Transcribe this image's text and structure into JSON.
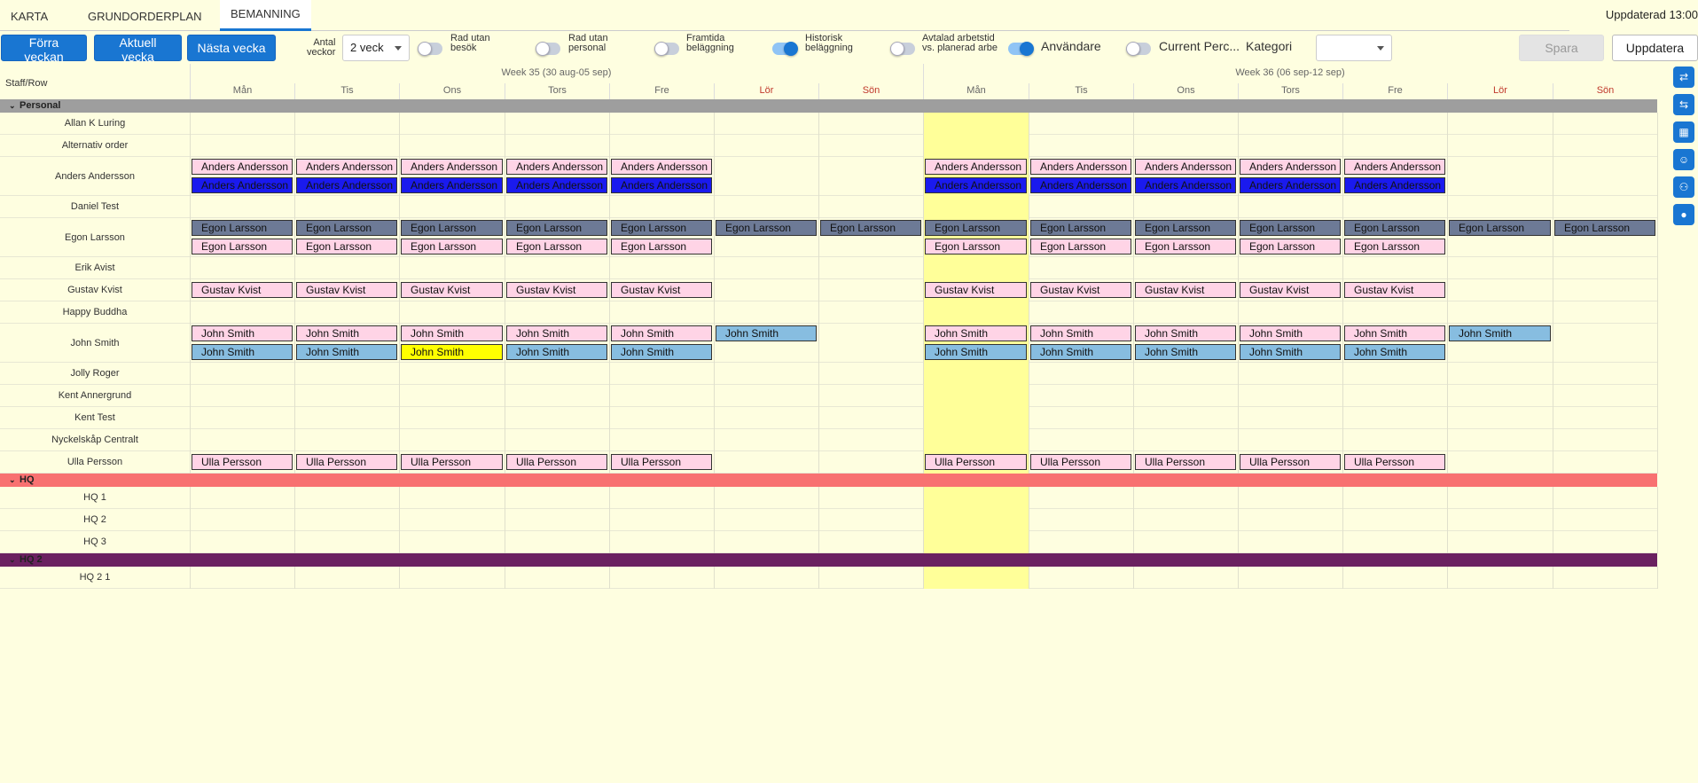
{
  "nav": {
    "tabs": [
      {
        "label": "KARTA"
      },
      {
        "label": "GRUNDORDERPLAN"
      },
      {
        "label": "BEMANNING"
      }
    ],
    "updated": "Uppdaterad 13:00"
  },
  "toolbar": {
    "prev_week": "Förra veckan",
    "current_week": "Aktuell vecka",
    "next_week": "Nästa vecka",
    "weeks_count_label": "Antal\nveckor",
    "weeks_count_value": "2 veck",
    "toggles": [
      {
        "label": "Rad utan\nbesök",
        "on": false
      },
      {
        "label": "Rad utan\npersonal",
        "on": false
      },
      {
        "label": "Framtida\nbeläggning",
        "on": false
      },
      {
        "label": "Historisk\nbeläggning",
        "on": true
      },
      {
        "label": "Avtalad arbetstid\nvs. planerad arbe",
        "on": false
      },
      {
        "label": "Användare",
        "on": true
      },
      {
        "label": "Current Perc...",
        "on": false
      }
    ],
    "category_label": "Kategori",
    "category_value": "",
    "save": "Spara",
    "refresh": "Uppdatera"
  },
  "grid": {
    "staff_row_label": "Staff/Row",
    "weeks": [
      {
        "label": "Week 35 (30 aug-05 sep)"
      },
      {
        "label": "Week 36 (06 sep-12 sep)"
      }
    ],
    "days": [
      "Mån",
      "Tis",
      "Ons",
      "Tors",
      "Fre",
      "Lör",
      "Sön",
      "Mån",
      "Tis",
      "Ons",
      "Tors",
      "Fre",
      "Lör",
      "Sön"
    ],
    "weekend_color": "#c0392b",
    "today_index": 7,
    "groups": [
      {
        "name": "Personal",
        "color": "#9e9e9e",
        "rows": [
          {
            "name": "Allan K Luring",
            "lines": []
          },
          {
            "name": "Alternativ order",
            "lines": []
          },
          {
            "name": "Anders Andersson",
            "lines": [
              {
                "style": "pink",
                "label": "Anders Andersson",
                "days": [
                  0,
                  1,
                  2,
                  3,
                  4,
                  7,
                  8,
                  9,
                  10,
                  11
                ]
              },
              {
                "style": "blue",
                "label": "Anders Andersson",
                "days": [
                  0,
                  1,
                  2,
                  3,
                  4,
                  7,
                  8,
                  9,
                  10,
                  11
                ]
              }
            ]
          },
          {
            "name": "Daniel Test",
            "lines": []
          },
          {
            "name": "Egon Larsson",
            "lines": [
              {
                "style": "slate",
                "label": "Egon Larsson",
                "days": [
                  0,
                  1,
                  2,
                  3,
                  4,
                  5,
                  6,
                  7,
                  8,
                  9,
                  10,
                  11,
                  12,
                  13
                ]
              },
              {
                "style": "pink",
                "label": "Egon Larsson",
                "days": [
                  0,
                  1,
                  2,
                  3,
                  4,
                  7,
                  8,
                  9,
                  10,
                  11
                ]
              }
            ]
          },
          {
            "name": "Erik Avist",
            "lines": []
          },
          {
            "name": "Gustav Kvist",
            "lines": [
              {
                "style": "pink",
                "label": "Gustav Kvist",
                "days": [
                  0,
                  1,
                  2,
                  3,
                  4,
                  7,
                  8,
                  9,
                  10,
                  11
                ]
              }
            ]
          },
          {
            "name": "Happy Buddha",
            "lines": []
          },
          {
            "name": "John Smith",
            "lines": [
              {
                "style": "pink",
                "label": "John Smith",
                "days": [
                  0,
                  1,
                  2,
                  3,
                  4,
                  7,
                  8,
                  9,
                  10,
                  11
                ],
                "sky_days": [
                  5,
                  12
                ]
              },
              {
                "style": "sky",
                "label": "John Smith",
                "days": [
                  0,
                  1,
                  3,
                  4,
                  7,
                  8,
                  9,
                  10,
                  11
                ],
                "yellow_days": [
                  2
                ]
              }
            ]
          },
          {
            "name": "Jolly Roger",
            "lines": []
          },
          {
            "name": "Kent Annergrund",
            "lines": []
          },
          {
            "name": "Kent Test",
            "lines": []
          },
          {
            "name": "Nyckelskåp Centralt",
            "lines": []
          },
          {
            "name": "Ulla Persson",
            "lines": [
              {
                "style": "pink",
                "label": "Ulla Persson",
                "days": [
                  0,
                  1,
                  2,
                  3,
                  4,
                  7,
                  8,
                  9,
                  10,
                  11
                ]
              }
            ]
          }
        ]
      },
      {
        "name": "HQ",
        "color": "#f87171",
        "rows": [
          {
            "name": "HQ 1",
            "lines": []
          },
          {
            "name": "HQ 2",
            "lines": []
          },
          {
            "name": "HQ 3",
            "lines": []
          }
        ]
      },
      {
        "name": "HQ 2",
        "color": "#6b2161",
        "rows": [
          {
            "name": "HQ 2 1",
            "lines": []
          }
        ]
      }
    ]
  },
  "sidebar": {
    "icons": [
      "sync-icon",
      "swap-icon",
      "calendar-icon",
      "person-badge-icon",
      "group-icon",
      "user-icon"
    ]
  }
}
